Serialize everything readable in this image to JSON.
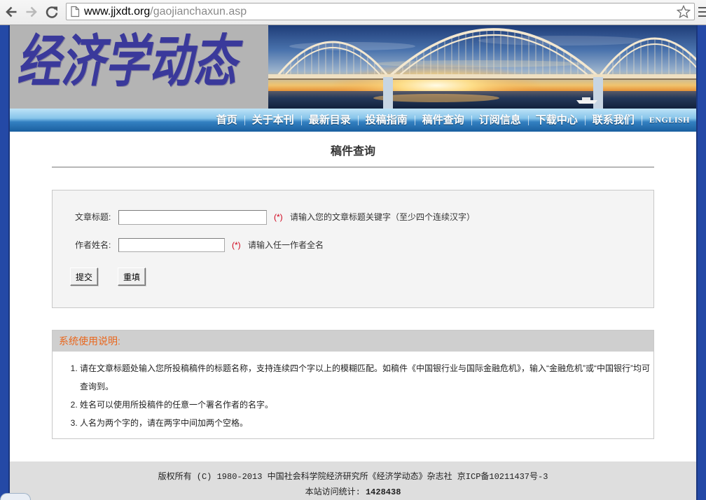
{
  "browser": {
    "url_host": "www.jjxdt.org",
    "url_path": "/gaojianchaxun.asp",
    "icons": [
      "back-arrow-icon",
      "forward-arrow-icon",
      "reload-icon",
      "page-icon",
      "star-icon",
      "menu-icon"
    ]
  },
  "header": {
    "logo_text": "经济学动态"
  },
  "nav": {
    "items": [
      "首页",
      "关于本刊",
      "最新目录",
      "投稿指南",
      "稿件查询",
      "订阅信息",
      "下载中心",
      "联系我们",
      "ENGLISH"
    ]
  },
  "page": {
    "title": "稿件查询"
  },
  "form": {
    "title_label": "文章标题:",
    "title_value": "",
    "title_required": "(*)",
    "title_hint": "请输入您的文章标题关键字（至少四个连续汉字）",
    "author_label": "作者姓名:",
    "author_value": "",
    "author_required": "(*)",
    "author_hint": "请输入任一作者全名",
    "submit_label": "提交",
    "reset_label": "重填"
  },
  "instructions": {
    "heading": "系统使用说明:",
    "items": [
      "请在文章标题处输入您所投稿稿件的标题名称，支持连续四个字以上的模糊匹配。如稿件《中国银行业与国际金融危机》，输入“金融危机”或“中国银行”均可查询到。",
      "姓名可以使用所投稿件的任意一个署名作者的名字。",
      "人名为两个字的，请在两字中间加两个空格。"
    ]
  },
  "footer": {
    "copyright": "版权所有 (C) 1980-2013 中国社会科学院经济研究所《经济学动态》杂志社 京ICP备10211437号-3",
    "visit_label": "本站访问统计:",
    "visit_count": "1428438"
  },
  "colors": {
    "frame_blue": "#2449a6",
    "nav_light": "#bfe3f7",
    "nav_dark": "#1a5f9f",
    "logo_bg": "#b4b4b4",
    "logo_ink": "#3a399b",
    "required_red": "#d0021b",
    "instructions_heading_orange": "#e9661c",
    "instructions_header_bg": "#cfcfcf",
    "form_bg": "#f4f4f4",
    "footer_bg": "#dedede"
  }
}
